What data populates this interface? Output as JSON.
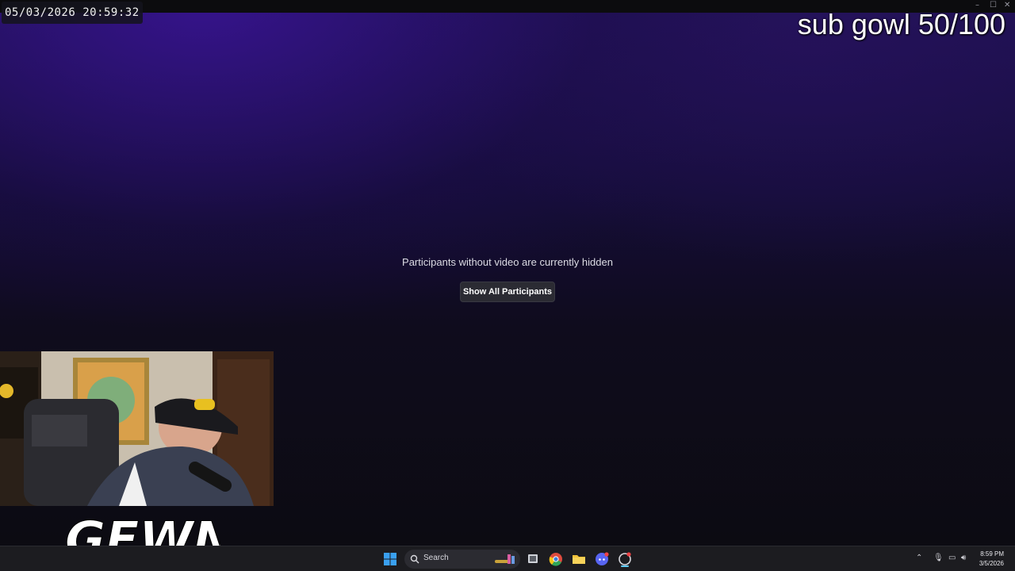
{
  "overlay": {
    "timestamp": "05/03/2026 20:59:32",
    "sub_goal": "sub gowl 50/100"
  },
  "call": {
    "hidden_message": "Participants without video are currently hidden",
    "show_all_label": "Show All Participants"
  },
  "stream_logo": "GEWN",
  "taskbar": {
    "search_label": "Search",
    "time": "8:59 PM",
    "date": "3/5/2026",
    "pinned": [
      "windows-start-icon",
      "search-icon",
      "task-view-icon",
      "chrome-icon",
      "file-explorer-icon",
      "discord-icon",
      "app-icon"
    ]
  },
  "colors": {
    "bg_top": "#1e1152",
    "bg_bottom": "#0c0b12",
    "button_bg": "#2b2b33",
    "taskbar_bg": "#1c1c20"
  }
}
